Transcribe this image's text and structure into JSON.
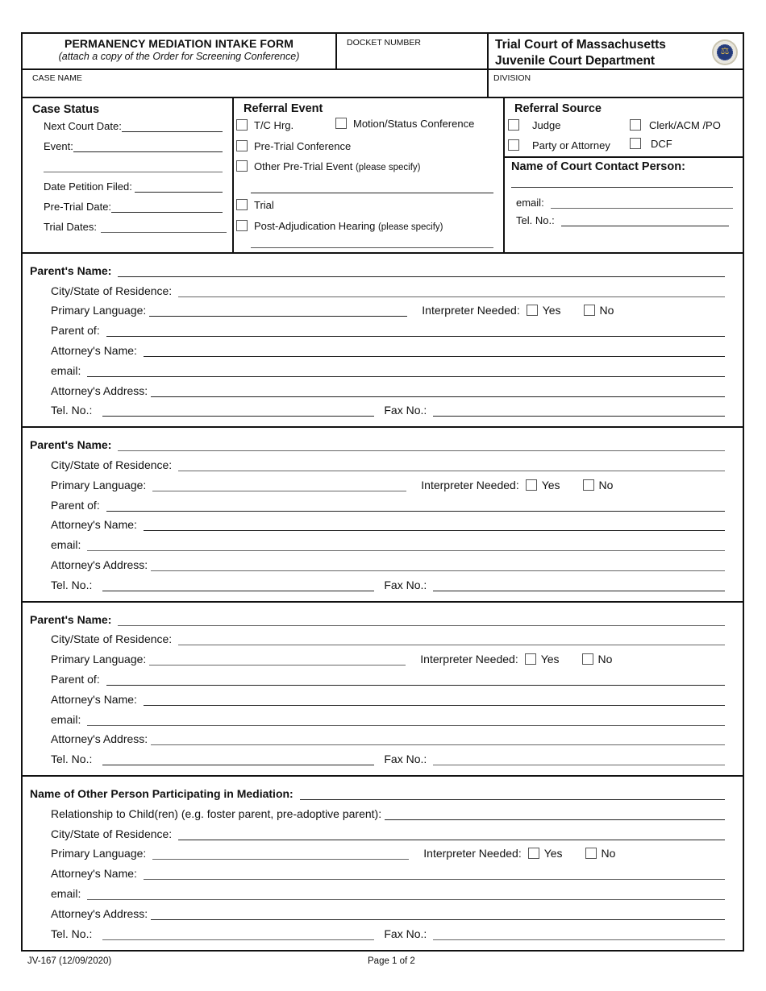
{
  "header": {
    "form_title": "PERMANENCY MEDIATION INTAKE FORM",
    "form_subtitle": "(attach a copy of the Order for Screening Conference)",
    "docket_label": "DOCKET NUMBER",
    "docket_value": "",
    "court_line1": "Trial Court of Massachusetts",
    "court_line2": "Juvenile Court Department",
    "seal_icon": "court-seal-icon",
    "case_name_label": "CASE NAME",
    "case_name_value": "",
    "division_label": "DIVISION",
    "division_value": ""
  },
  "case_status": {
    "title": "Case Status",
    "fields": [
      {
        "label": "Next Court Date:",
        "value": ""
      },
      {
        "label": "Event:",
        "value": ""
      },
      {
        "label": "",
        "value": ""
      },
      {
        "label": "Date Petition Filed:",
        "value": ""
      },
      {
        "label": "Pre-Trial Date:",
        "value": ""
      },
      {
        "label": "Trial Dates:",
        "value": ""
      }
    ]
  },
  "referral_event": {
    "title": "Referral Event",
    "options": [
      {
        "label": "T/C Hrg.",
        "note": "",
        "checked": false
      },
      {
        "label": "Motion/Status Conference",
        "note": "",
        "checked": false
      },
      {
        "label": "Pre-Trial Conference",
        "note": "",
        "checked": false
      },
      {
        "label": "Other Pre-Trial Event",
        "note": "(please specify)",
        "checked": false
      },
      {
        "label": "Trial",
        "note": "",
        "checked": false
      },
      {
        "label": "Post-Adjudication Hearing",
        "note": "(please specify)",
        "checked": false
      }
    ],
    "other_specify_value": "",
    "post_adjudication_specify_value": ""
  },
  "referral_source": {
    "title": "Referral Source",
    "options": [
      {
        "label": "Judge",
        "checked": false
      },
      {
        "label": "Clerk/ACM /PO",
        "checked": false
      },
      {
        "label": "Party or Attorney",
        "checked": false
      },
      {
        "label": "DCF",
        "checked": false
      }
    ],
    "contact_title": "Name of Court Contact Person:",
    "contact_name_value": "",
    "email_label": "email:",
    "email_value": "",
    "tel_label": "Tel. No.:",
    "tel_value": ""
  },
  "labels": {
    "city_state": "City/State of Residence:",
    "primary_language": "Primary Language:",
    "interpreter_needed": "Interpreter Needed:",
    "yes": "Yes",
    "no": "No",
    "parent_of": "Parent of:",
    "attorney_name": "Attorney's Name:",
    "email": "email:",
    "attorney_address": "Attorney's Address:",
    "tel": "Tel. No.:",
    "fax": "Fax No.:",
    "relationship": "Relationship to Child(ren) (e.g. foster parent, pre-adoptive parent):"
  },
  "parents": [
    {
      "heading": "Parent's Name:",
      "name": "",
      "city_state": "",
      "primary_language": "",
      "interpreter_yes": false,
      "interpreter_no": false,
      "parent_of": "",
      "attorney_name": "",
      "email": "",
      "attorney_address": "",
      "tel": "",
      "fax": ""
    },
    {
      "heading": "Parent's Name:",
      "name": "",
      "city_state": "",
      "primary_language": "",
      "interpreter_yes": false,
      "interpreter_no": false,
      "parent_of": "",
      "attorney_name": "",
      "email": "",
      "attorney_address": "",
      "tel": "",
      "fax": ""
    },
    {
      "heading": "Parent's Name:",
      "name": "",
      "city_state": "",
      "primary_language": "",
      "interpreter_yes": false,
      "interpreter_no": false,
      "parent_of": "",
      "attorney_name": "",
      "email": "",
      "attorney_address": "",
      "tel": "",
      "fax": ""
    }
  ],
  "other_person": {
    "heading": "Name of Other Person Participating in Mediation:",
    "name": "",
    "relationship": "",
    "city_state": "",
    "primary_language": "",
    "interpreter_yes": false,
    "interpreter_no": false,
    "attorney_name": "",
    "email": "",
    "attorney_address": "",
    "tel": "",
    "fax": ""
  },
  "footer": {
    "form_code": "JV-167 (12/09/2020)",
    "page": "Page 1 of 2"
  }
}
